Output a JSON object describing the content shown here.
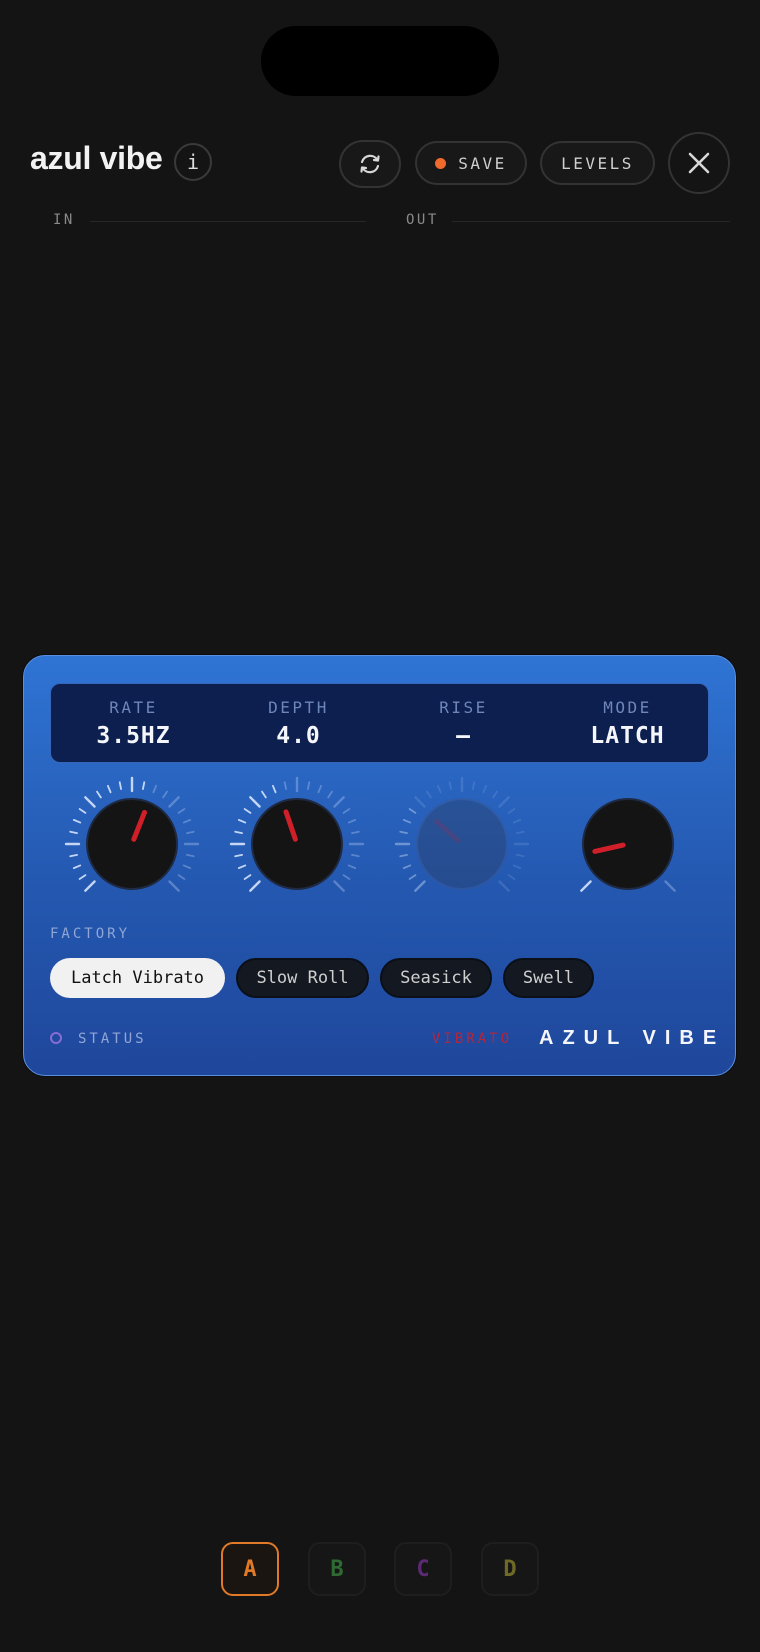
{
  "header": {
    "title": "azul vibe",
    "info_label": "i",
    "sync_icon": "sync-icon",
    "save_label": "SAVE",
    "save_indicator_color": "#f06a2b",
    "levels_label": "LEVELS",
    "close_icon": "close-icon"
  },
  "meters": {
    "in_label": "IN",
    "out_label": "OUT"
  },
  "device": {
    "readouts": [
      {
        "label": "RATE",
        "value": "3.5HZ"
      },
      {
        "label": "DEPTH",
        "value": "4.0"
      },
      {
        "label": "RISE",
        "value": "—"
      },
      {
        "label": "MODE",
        "value": "LATCH"
      }
    ],
    "knobs": [
      {
        "name": "rate",
        "position": 0.58,
        "enabled": true
      },
      {
        "name": "depth",
        "position": 0.43,
        "enabled": true
      },
      {
        "name": "rise",
        "position": 0.32,
        "enabled": false
      },
      {
        "name": "mode",
        "position": 0.12,
        "enabled": true,
        "stepped": true
      }
    ],
    "section_label": "FACTORY",
    "presets": [
      {
        "label": "Latch Vibrato",
        "active": true
      },
      {
        "label": "Slow Roll",
        "active": false
      },
      {
        "label": "Seasick",
        "active": false
      },
      {
        "label": "Swell",
        "active": false
      }
    ],
    "status_label": "STATUS",
    "type_label": "VIBRATO",
    "brand_label": "AZUL VIBE",
    "accent_color": "#d11f2a",
    "body_color": "#2a63c2"
  },
  "slots": [
    {
      "label": "A",
      "color": "#e07a28",
      "active": true
    },
    {
      "label": "B",
      "color": "#2e6a31",
      "active": false
    },
    {
      "label": "C",
      "color": "#5c2a74",
      "active": false
    },
    {
      "label": "D",
      "color": "#6e6a25",
      "active": false
    }
  ]
}
